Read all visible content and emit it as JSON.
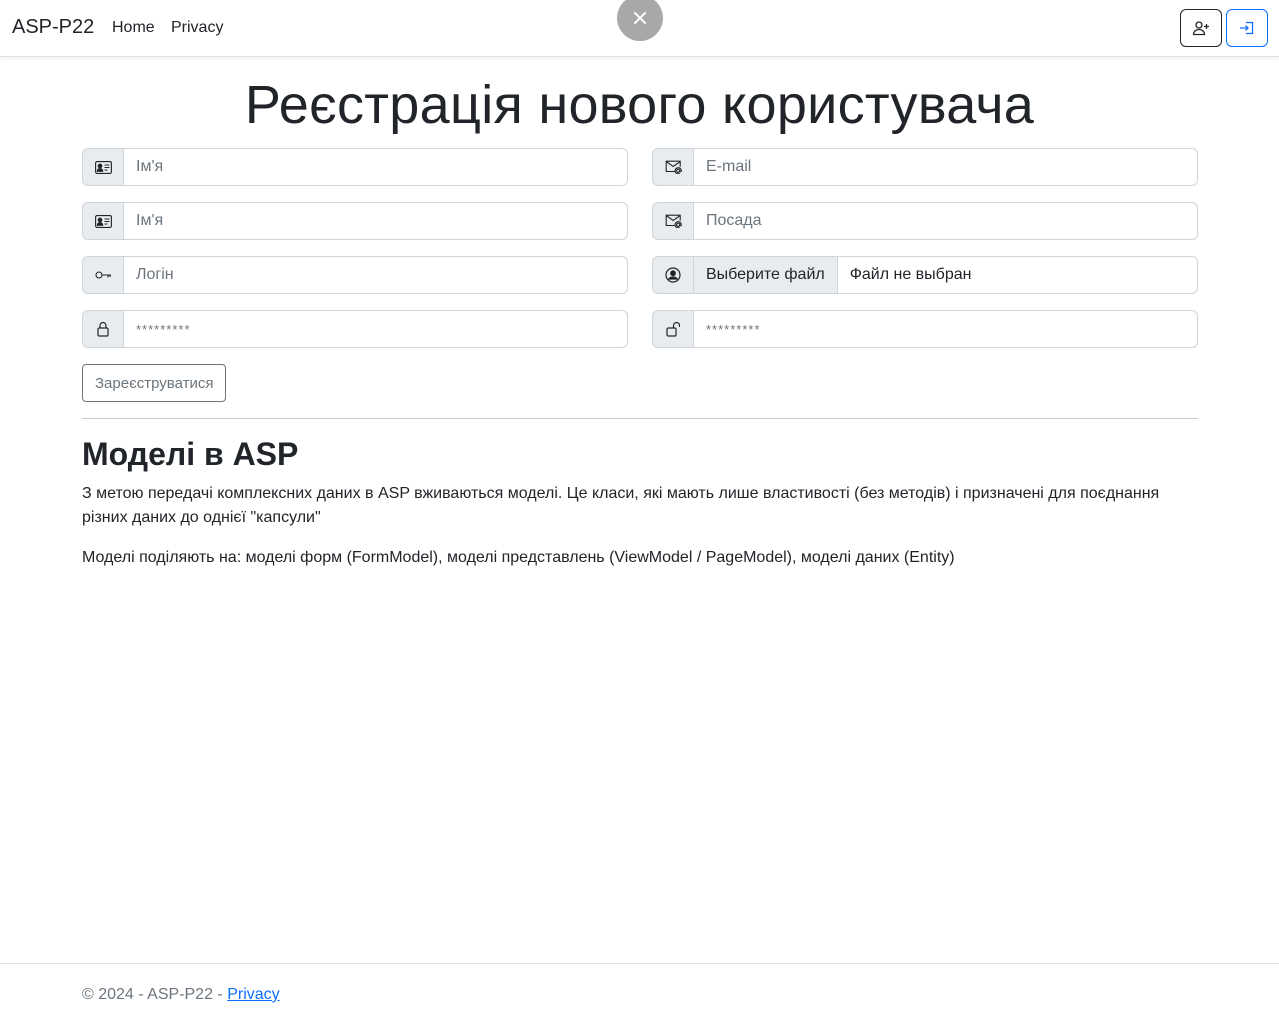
{
  "nav": {
    "brand": "ASP-P22",
    "links": [
      "Home",
      "Privacy"
    ],
    "signup_icon": "person-plus-icon",
    "login_icon": "box-arrow-in-right-icon"
  },
  "overlay": {
    "close_icon": "close-icon"
  },
  "form": {
    "title": "Реєстрація нового користувача",
    "fields": {
      "first_name": {
        "placeholder": "Ім'я",
        "icon": "person-vcard-icon"
      },
      "email": {
        "placeholder": "E-mail",
        "icon": "envelope-at-icon"
      },
      "last_name": {
        "placeholder": "Ім'я",
        "icon": "person-vcard-icon"
      },
      "position": {
        "placeholder": "Посада",
        "icon": "envelope-at-icon"
      },
      "login": {
        "placeholder": "Логін",
        "icon": "key-icon"
      },
      "avatar": {
        "button": "Выберите файл",
        "status": "Файл не выбран",
        "icon": "person-circle-icon"
      },
      "password": {
        "placeholder": "*********",
        "icon": "lock-icon"
      },
      "password_repeat": {
        "placeholder": "*********",
        "icon": "unlock-icon"
      }
    },
    "submit_label": "Зареєструватися"
  },
  "section": {
    "title": "Моделі в ASP",
    "paragraphs": [
      "З метою передачі комплексних даних в ASP вживаються моделі. Це класи, які мають лише властивості (без методів) і призначені для поєднання різних даних до однієї \"капсули\"",
      "Моделі поділяють на: моделі форм (FormModel), моделі представлень (ViewModel / PageModel), моделі даних (Entity)"
    ]
  },
  "footer": {
    "text": "© 2024 - ASP-P22 - ",
    "link": "Privacy"
  },
  "colors": {
    "primary": "#0d6efd",
    "addon_bg": "#e9ecef",
    "border": "#ced4da",
    "muted": "#6c757d"
  }
}
